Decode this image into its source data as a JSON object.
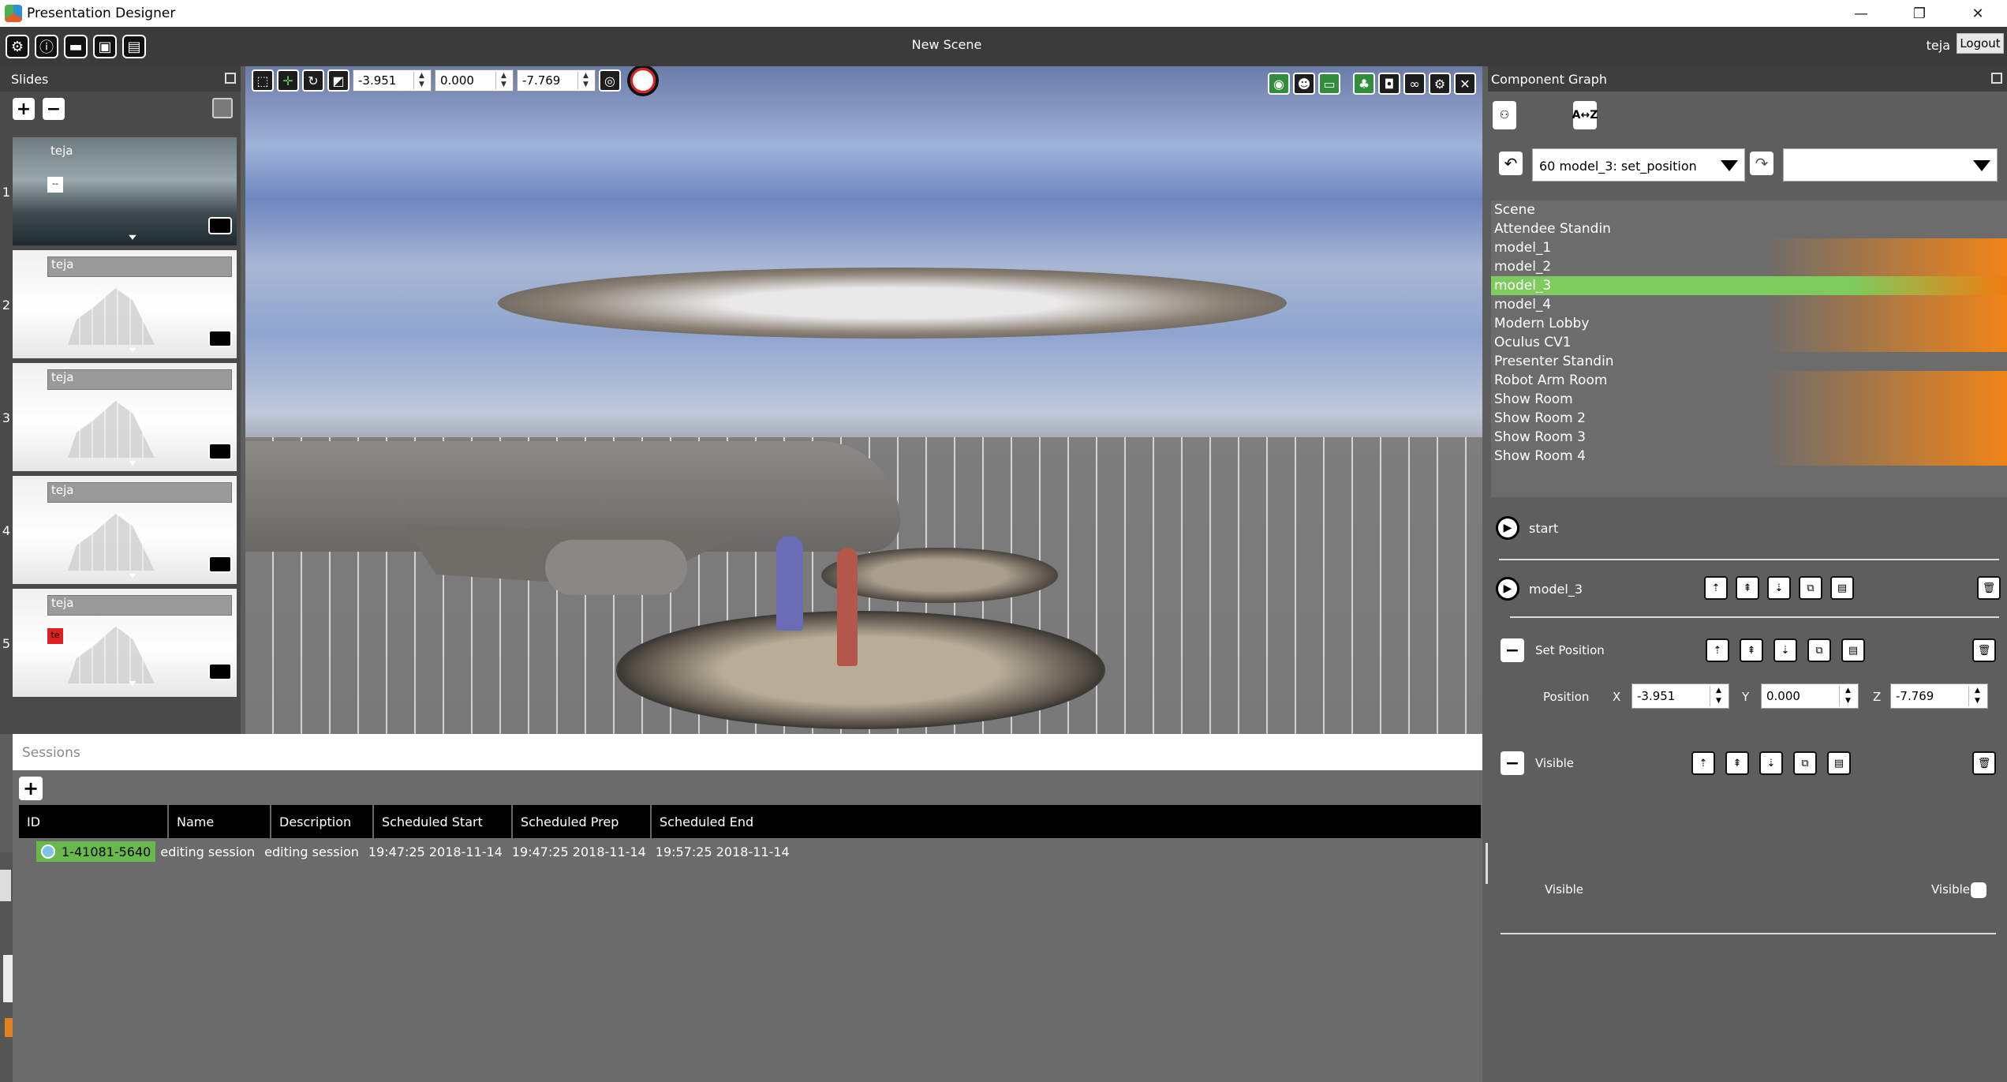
{
  "window": {
    "title": "Presentation Designer",
    "minimize": "—",
    "restore": "❐",
    "close": "✕"
  },
  "toolbar": {
    "scene_title": "New Scene",
    "user": "teja",
    "logout_label": "Logout",
    "icons": [
      "settings-icon",
      "info-icon",
      "graduation-icon",
      "presenter-icon",
      "slides-icon"
    ]
  },
  "slides": {
    "title": "Slides",
    "items": [
      {
        "number": "1",
        "name": "teja",
        "tag": "--"
      },
      {
        "number": "2",
        "name": "teja"
      },
      {
        "number": "3",
        "name": "teja"
      },
      {
        "number": "4",
        "name": "teja"
      },
      {
        "number": "5",
        "name": "teja",
        "tag": "te"
      }
    ]
  },
  "viewport": {
    "x": "-3.951",
    "y": "0.000",
    "z": "-7.769"
  },
  "sessions": {
    "title": "Sessions",
    "columns": [
      "ID",
      "Name",
      "Description",
      "Scheduled Start",
      "Scheduled Prep",
      "Scheduled End"
    ],
    "rows": [
      {
        "id": "1-41081-5640",
        "name": "editing session",
        "description": "editing session",
        "start": "19:47:25 2018-11-14",
        "prep": "19:47:25 2018-11-14",
        "end": "19:57:25 2018-11-14"
      }
    ]
  },
  "component_graph": {
    "title": "Component Graph",
    "sort_label": "A↔Z",
    "selected_action": "60 model_3: set_position",
    "tree": [
      "Scene",
      "Attendee Standin",
      "model_1",
      "model_2",
      "model_3",
      "model_4",
      "Modern Lobby",
      "Oculus CV1",
      "Presenter Standin",
      "Robot Arm Room",
      "Show Room",
      "Show Room 2",
      "Show Room 3",
      "Show Room 4"
    ],
    "selected_index": 4,
    "rows": {
      "start": "start",
      "model": "model_3",
      "set_position": "Set Position",
      "position_label": "Position",
      "x_label": "X",
      "x_value": "-3.951",
      "y_label": "Y",
      "y_value": "0.000",
      "z_label": "Z",
      "z_value": "-7.769",
      "visible_section": "Visible",
      "visible_label": "Visible",
      "visible_check_label": "Visible"
    }
  },
  "colors": {
    "selected": "#7ecb5e",
    "highlight": "#f08418",
    "session_id": "#68b84b"
  }
}
